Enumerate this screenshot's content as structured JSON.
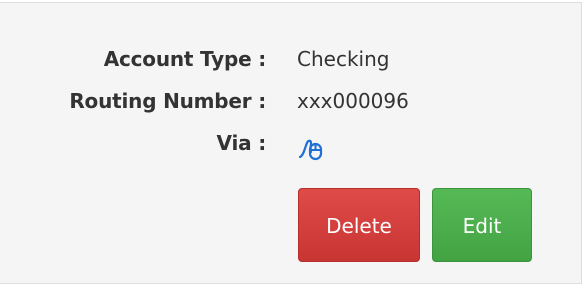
{
  "account": {
    "fields": [
      {
        "label": "Account Type :",
        "value": "Checking"
      },
      {
        "label": "Routing Number :",
        "value": "xxx000096"
      },
      {
        "label": "Via :",
        "value_icon": "mouse-pointer-icon"
      }
    ]
  },
  "actions": {
    "delete_label": "Delete",
    "edit_label": "Edit"
  },
  "colors": {
    "delete_button": "#d43f3a",
    "edit_button": "#4cae4c",
    "via_icon": "#1f6fd6",
    "panel_background": "#f5f5f5"
  }
}
